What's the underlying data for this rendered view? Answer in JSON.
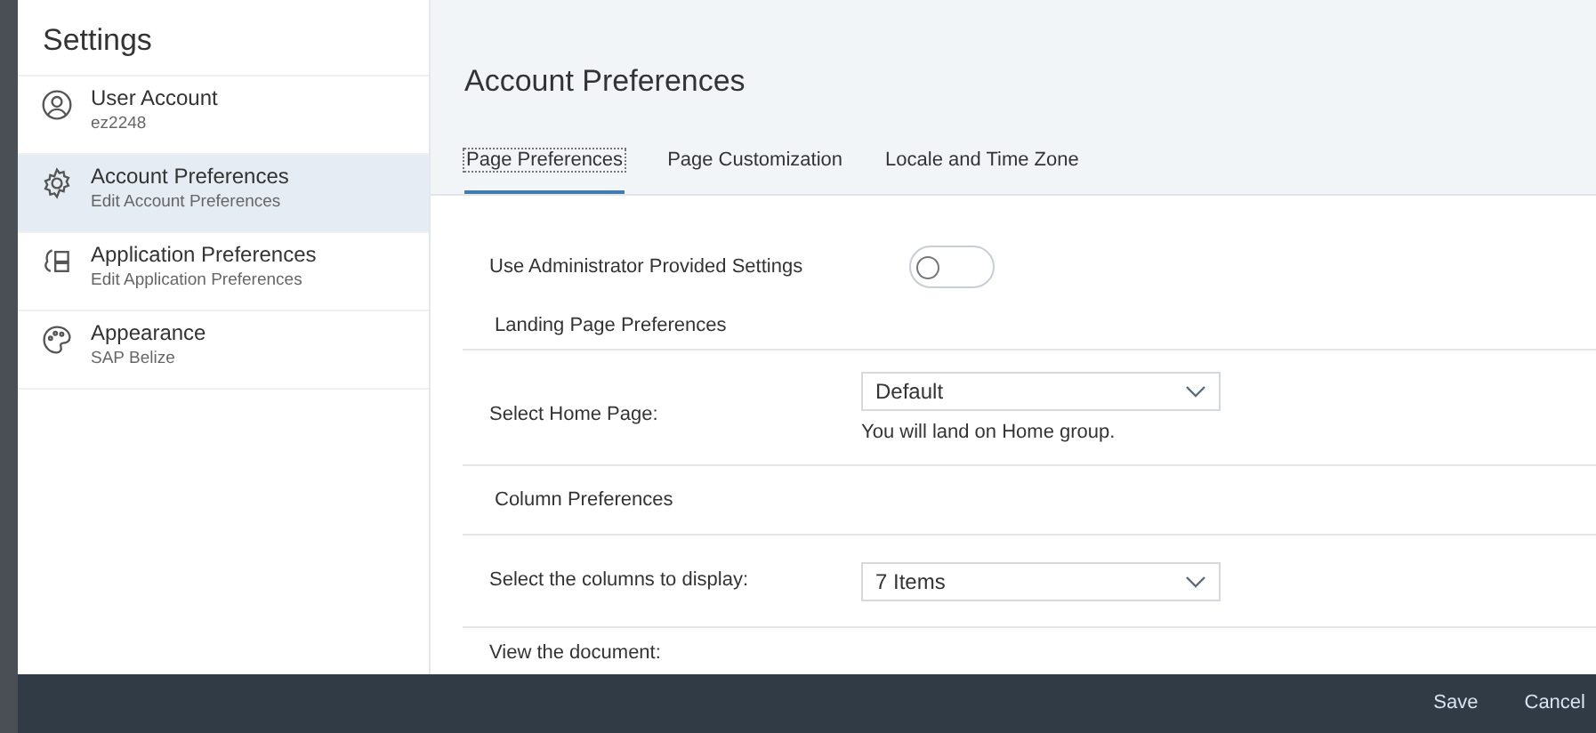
{
  "sidebar": {
    "title": "Settings",
    "items": [
      {
        "label": "User Account",
        "sublabel": "ez2248",
        "selected": false
      },
      {
        "label": "Account Preferences",
        "sublabel": "Edit Account Preferences",
        "selected": true
      },
      {
        "label": "Application Preferences",
        "sublabel": "Edit Application Preferences",
        "selected": false
      },
      {
        "label": "Appearance",
        "sublabel": "SAP Belize",
        "selected": false
      }
    ]
  },
  "header": {
    "title": "Account Preferences"
  },
  "tabs": [
    {
      "label": "Page Preferences",
      "selected": true
    },
    {
      "label": "Page Customization",
      "selected": false
    },
    {
      "label": "Locale and Time Zone",
      "selected": false
    }
  ],
  "toggle": {
    "label": "Use Administrator Provided Settings",
    "on": false
  },
  "sections": [
    {
      "title": "Landing Page Preferences",
      "field": {
        "label": "Select Home Page:",
        "value": "Default",
        "hint": "You will land on Home group."
      }
    },
    {
      "title": "Column Preferences",
      "field": {
        "label": "Select the columns to display:",
        "value": "7 Items"
      }
    }
  ],
  "next_label": "View the document:",
  "footer": {
    "buttons": [
      "Save",
      "Cancel"
    ]
  }
}
